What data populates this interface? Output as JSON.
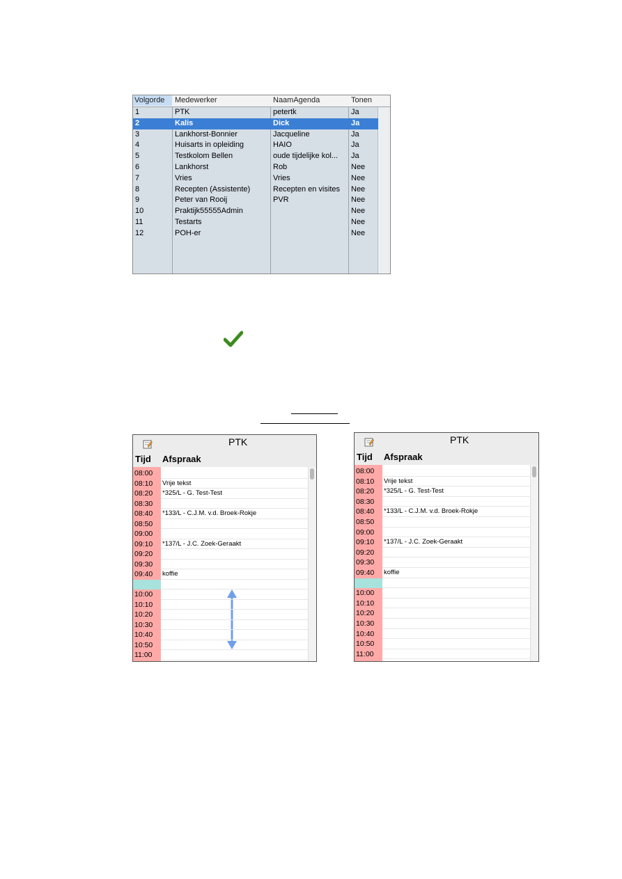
{
  "table": {
    "headers": [
      "Volgorde",
      "Medewerker",
      "NaamAgenda",
      "Tonen"
    ],
    "rows": [
      [
        "1",
        "PTK",
        "petertk",
        "Ja"
      ],
      [
        "2",
        "Kalis",
        "Dick",
        "Ja"
      ],
      [
        "3",
        "Lankhorst-Bonnier",
        "Jacqueline",
        "Ja"
      ],
      [
        "4",
        "Huisarts in opleiding",
        "HAIO",
        "Ja"
      ],
      [
        "5",
        "Testkolom Bellen",
        "oude tijdelijke kol...",
        "Ja"
      ],
      [
        "6",
        "Lankhorst",
        "Rob",
        "Nee"
      ],
      [
        "7",
        "Vries",
        "Vries",
        "Nee"
      ],
      [
        "8",
        "Recepten (Assistente)",
        "Recepten en visites",
        "Nee"
      ],
      [
        "9",
        "Peter van Rooij",
        "PVR",
        "Nee"
      ],
      [
        "10",
        "Praktijk55555Admin",
        "",
        "Nee"
      ],
      [
        "11",
        "Testarts",
        "",
        "Nee"
      ],
      [
        "12",
        "POH-er",
        "",
        "Nee"
      ]
    ],
    "selected_row": 1
  },
  "agenda_left": {
    "title": "PTK",
    "col_time": "Tijd",
    "col_appt": "Afspraak",
    "slots": [
      {
        "time": "08:00",
        "text": ""
      },
      {
        "time": "08:10",
        "text": "Vrije tekst"
      },
      {
        "time": "08:20",
        "text": "*325/L - G. Test-Test",
        "pink": true
      },
      {
        "time": "08:30",
        "text": ""
      },
      {
        "time": "08:40",
        "text": "*133/L - C.J.M. v.d. Broek-Rokje",
        "pink": true
      },
      {
        "time": "08:50",
        "text": ""
      },
      {
        "time": "09:00",
        "text": ""
      },
      {
        "time": "09:10",
        "text": "*137/L - J.C. Zoek-Geraakt",
        "pink": true
      },
      {
        "time": "09:20",
        "text": ""
      },
      {
        "time": "09:30",
        "text": ""
      },
      {
        "time": "09:40",
        "text": "koffie"
      },
      {
        "time": "",
        "text": "",
        "gap": true
      },
      {
        "time": "10:00",
        "text": ""
      },
      {
        "time": "10:10",
        "text": ""
      },
      {
        "time": "10:20",
        "text": ""
      },
      {
        "time": "10:30",
        "text": ""
      },
      {
        "time": "10:40",
        "text": ""
      },
      {
        "time": "10:50",
        "text": ""
      },
      {
        "time": "11:00",
        "text": ""
      }
    ]
  },
  "agenda_right": {
    "title": "PTK",
    "col_time": "Tijd",
    "col_appt": "Afspraak",
    "slots": [
      {
        "time": "08:00",
        "text": ""
      },
      {
        "time": "08:10",
        "text": "Vrije tekst"
      },
      {
        "time": "08:20",
        "text": "*325/L - G. Test-Test",
        "pink": true
      },
      {
        "time": "08:30",
        "text": ""
      },
      {
        "time": "08:40",
        "text": "*133/L - C.J.M. v.d. Broek-Rokje",
        "pink": true
      },
      {
        "time": "08:50",
        "text": ""
      },
      {
        "time": "09:00",
        "text": ""
      },
      {
        "time": "09:10",
        "text": "*137/L - J.C. Zoek-Geraakt",
        "pink": true
      },
      {
        "time": "09:20",
        "text": ""
      },
      {
        "time": "09:30",
        "text": ""
      },
      {
        "time": "09:40",
        "text": "koffie"
      },
      {
        "time": "",
        "text": "",
        "gap": true
      },
      {
        "time": "10:00",
        "text": ""
      },
      {
        "time": "10:10",
        "text": ""
      },
      {
        "time": "10:20",
        "text": ""
      },
      {
        "time": "10:30",
        "text": ""
      },
      {
        "time": "10:40",
        "text": ""
      },
      {
        "time": "10:50",
        "text": ""
      },
      {
        "time": "11:00",
        "text": ""
      }
    ]
  },
  "colors": {
    "selection": "#3a7fd5",
    "time_column": "#ffaaa8",
    "appointment": "#ffdcdc",
    "gap": "#a8e2dc",
    "check": "#3d8b1f",
    "arrow": "#6f9fe8"
  },
  "icons": {
    "check": "checkmark-icon",
    "note": "edit-note-icon",
    "arrow": "double-arrow-icon"
  }
}
